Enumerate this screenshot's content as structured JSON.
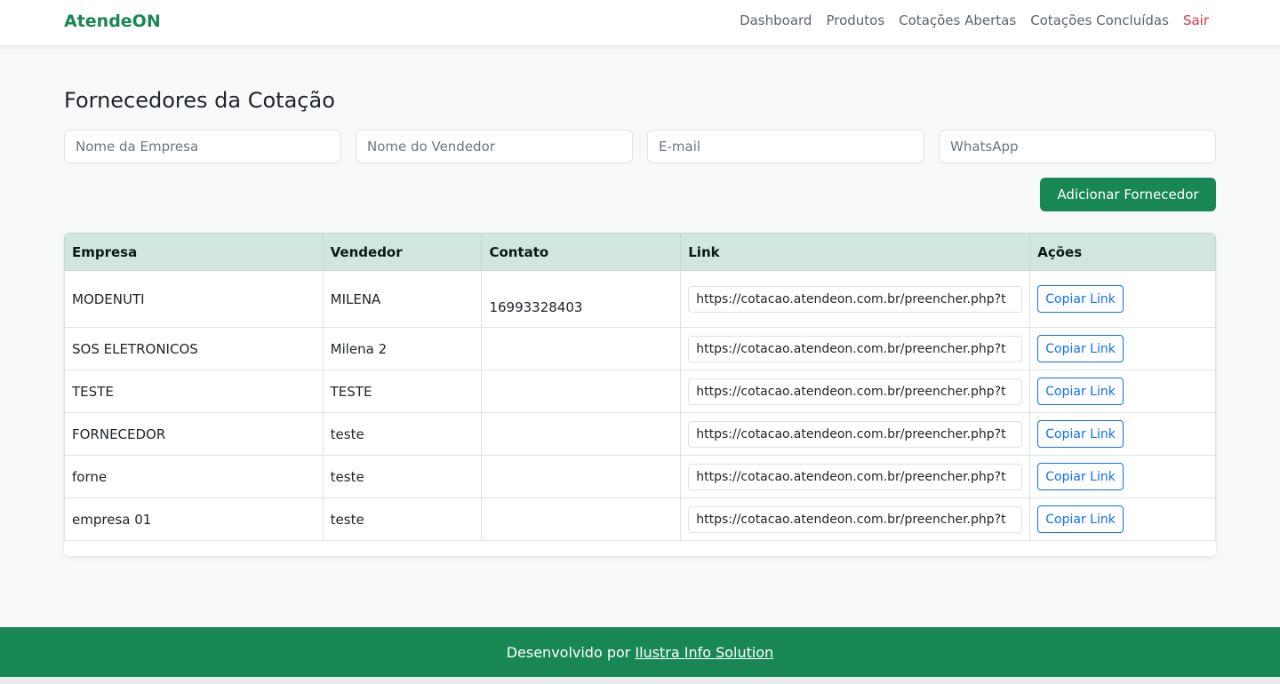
{
  "brand": "AtendeON",
  "nav": {
    "items": [
      "Dashboard",
      "Produtos",
      "Cotações Abertas",
      "Cotações Concluídas"
    ],
    "logout": "Sair"
  },
  "page_title": "Fornecedores da Cotação",
  "form": {
    "company_placeholder": "Nome da Empresa",
    "seller_placeholder": "Nome do Vendedor",
    "email_placeholder": "E-mail",
    "whatsapp_placeholder": "WhatsApp",
    "add_button": "Adicionar Fornecedor"
  },
  "table": {
    "headers": [
      "Empresa",
      "Vendedor",
      "Contato",
      "Link",
      "Ações"
    ],
    "copy_label": "Copiar Link",
    "rows": [
      {
        "empresa": "MODENUTI",
        "vendedor": "MILENA",
        "contato": "16993328403",
        "link": "https://cotacao.atendeon.com.br/preencher.php?t"
      },
      {
        "empresa": "SOS ELETRONICOS",
        "vendedor": "Milena 2",
        "contato": "",
        "link": "https://cotacao.atendeon.com.br/preencher.php?t"
      },
      {
        "empresa": "TESTE",
        "vendedor": "TESTE",
        "contato": "",
        "link": "https://cotacao.atendeon.com.br/preencher.php?t"
      },
      {
        "empresa": "FORNECEDOR",
        "vendedor": "teste",
        "contato": "",
        "link": "https://cotacao.atendeon.com.br/preencher.php?t"
      },
      {
        "empresa": "forne",
        "vendedor": "teste",
        "contato": "",
        "link": "https://cotacao.atendeon.com.br/preencher.php?t"
      },
      {
        "empresa": "empresa 01",
        "vendedor": "teste",
        "contato": "",
        "link": "https://cotacao.atendeon.com.br/preencher.php?t"
      }
    ]
  },
  "footer": {
    "prefix": "Desenvolvido por",
    "link_text": "Ilustra Info Solution"
  },
  "colors": {
    "brand_green": "#198754",
    "table_header_bg": "#d1e7dd",
    "link_blue": "#0d6efd",
    "logout_red": "#dc3545"
  }
}
